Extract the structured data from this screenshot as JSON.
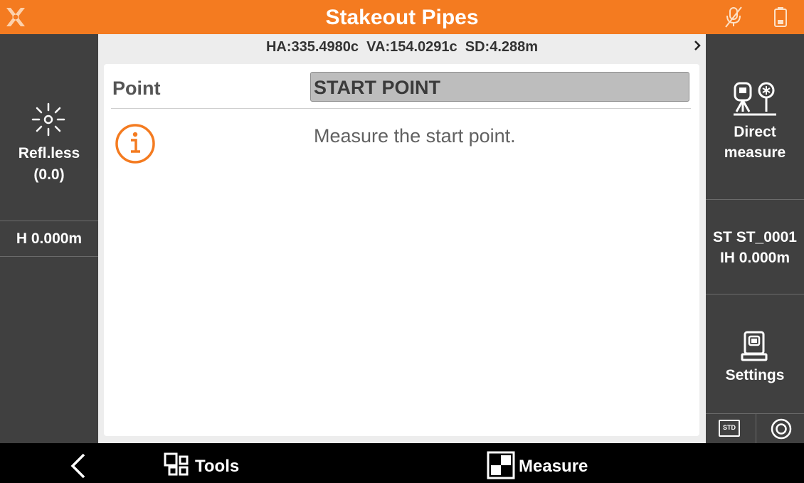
{
  "header": {
    "title": "Stakeout Pipes",
    "logo_icon": "x-logo-icon",
    "status_icons": [
      "mic-off-icon",
      "battery-icon"
    ],
    "accent_color": "#f47b20"
  },
  "left_panel": {
    "reflector": {
      "line1": "Refl.less",
      "line2": "(0.0)",
      "icon": "laser-icon"
    },
    "height": {
      "label": "H 0.000m"
    }
  },
  "measurement_bar": {
    "text": "HA:335.4980c  VA:154.0291c  SD:4.288m",
    "expand_icon": "chevron-right-icon"
  },
  "main": {
    "point_label": "Point",
    "point_value": "START POINT",
    "info_icon": "info-icon",
    "message": "Measure the start point."
  },
  "right_panel": {
    "direct_measure": {
      "line1": "Direct",
      "line2": "measure",
      "icon": "total-station-prism-icon"
    },
    "station": {
      "line1": "ST ST_0001",
      "line2": "IH 0.000m"
    },
    "settings": {
      "label": "Settings",
      "icon": "total-station-icon"
    },
    "mode_badge": "STD",
    "target_icon": "target-circle-icon"
  },
  "bottom_bar": {
    "back_icon": "back-arrow-icon",
    "tools_label": "Tools",
    "tools_icon": "grid-tools-icon",
    "measure_label": "Measure",
    "measure_icon": "measure-icon"
  }
}
